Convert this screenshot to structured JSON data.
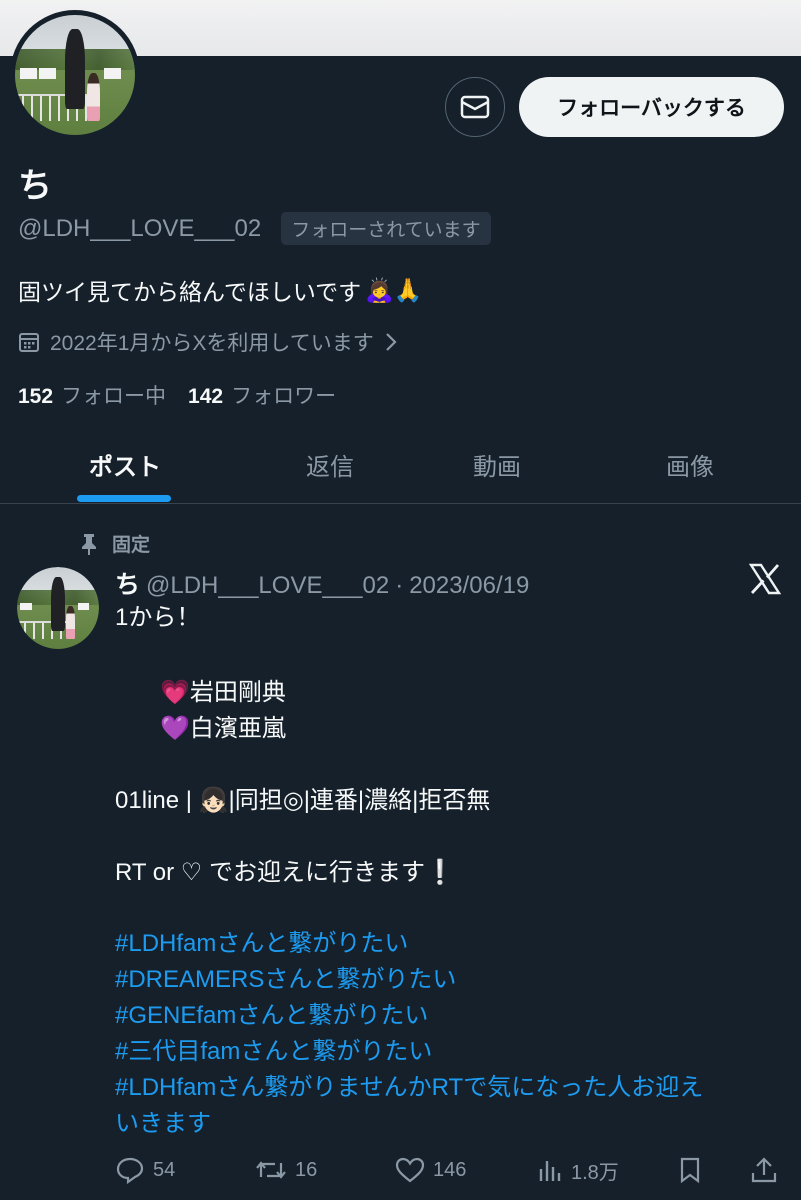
{
  "profile": {
    "display_name": "ち",
    "handle": "@LDH___LOVE___02",
    "follows_you": "フォローされています",
    "follow_back_label": "フォローバックする",
    "bio": "固ツイ見てから絡んでほしいです",
    "bio_emoji": "🙇‍♀️🙏",
    "joined": "2022年1月からXを利用しています",
    "following_count": "152",
    "following_label": "フォロー中",
    "followers_count": "142",
    "followers_label": "フォロワー"
  },
  "tabs": [
    {
      "label": "ポスト",
      "active": true
    },
    {
      "label": "返信",
      "active": false
    },
    {
      "label": "動画",
      "active": false
    },
    {
      "label": "画像",
      "active": false
    }
  ],
  "post": {
    "pinned_label": "固定",
    "author_name": "ち",
    "author_handle": "@LDH___LOVE___02",
    "separator": "·",
    "date": "2023/06/19",
    "lines": {
      "l1": "1から！",
      "l2_emoji": "💗",
      "l2": "岩田剛典",
      "l3_emoji": "💜",
      "l3": "白濱亜嵐",
      "l4a": "01line | ",
      "l4_emoji": "👧🏻",
      "l4b": "|同担◎|連番|濃絡|拒否無",
      "l5": "RT or ♡ でお迎えに行きます",
      "l5_emoji": "❕",
      "tag1": "#LDHfamさんと繋がりたい",
      "tag2": "#DREAMERSさんと繋がりたい",
      "tag3": "#GENEfamさんと繋がりたい",
      "tag4": "#三代目famさんと繋がりたい",
      "tag5a": "#LDHfamさん繋がりませんかRTで気になった人お迎え",
      "tag5b": "いきます"
    },
    "replies": "54",
    "reposts": "16",
    "likes": "146",
    "views": "1.8万"
  },
  "icons": [
    "mail-icon",
    "calendar-icon",
    "chevron-right-icon",
    "pin-icon",
    "x-logo-icon",
    "reply-icon",
    "repost-icon",
    "like-icon",
    "views-icon",
    "bookmark-icon",
    "share-icon"
  ]
}
